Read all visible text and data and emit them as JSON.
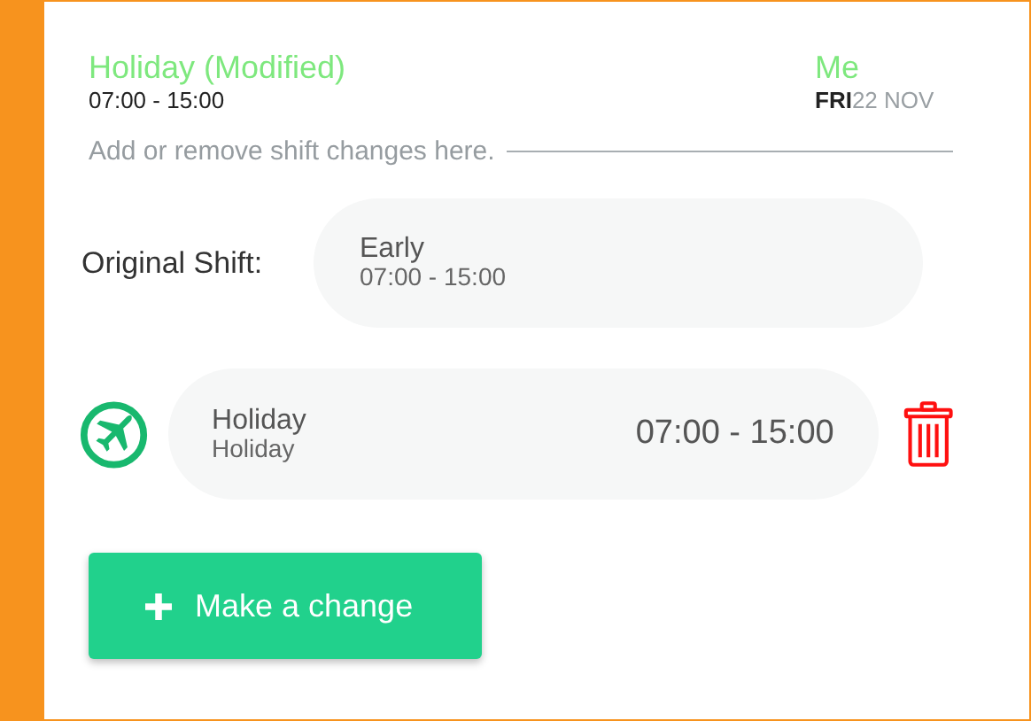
{
  "header": {
    "title": "Holiday (Modified)",
    "time": "07:00 - 15:00",
    "person": "Me",
    "day": "FRI",
    "date": "22 NOV"
  },
  "hint": "Add or remove shift changes here.",
  "original_shift": {
    "label": "Original Shift:",
    "name": "Early",
    "time": "07:00 - 15:00"
  },
  "changes": [
    {
      "kind": "holiday",
      "name": "Holiday",
      "type": "Holiday",
      "time": "07:00 - 15:00"
    }
  ],
  "button": {
    "label": "Make a change"
  }
}
